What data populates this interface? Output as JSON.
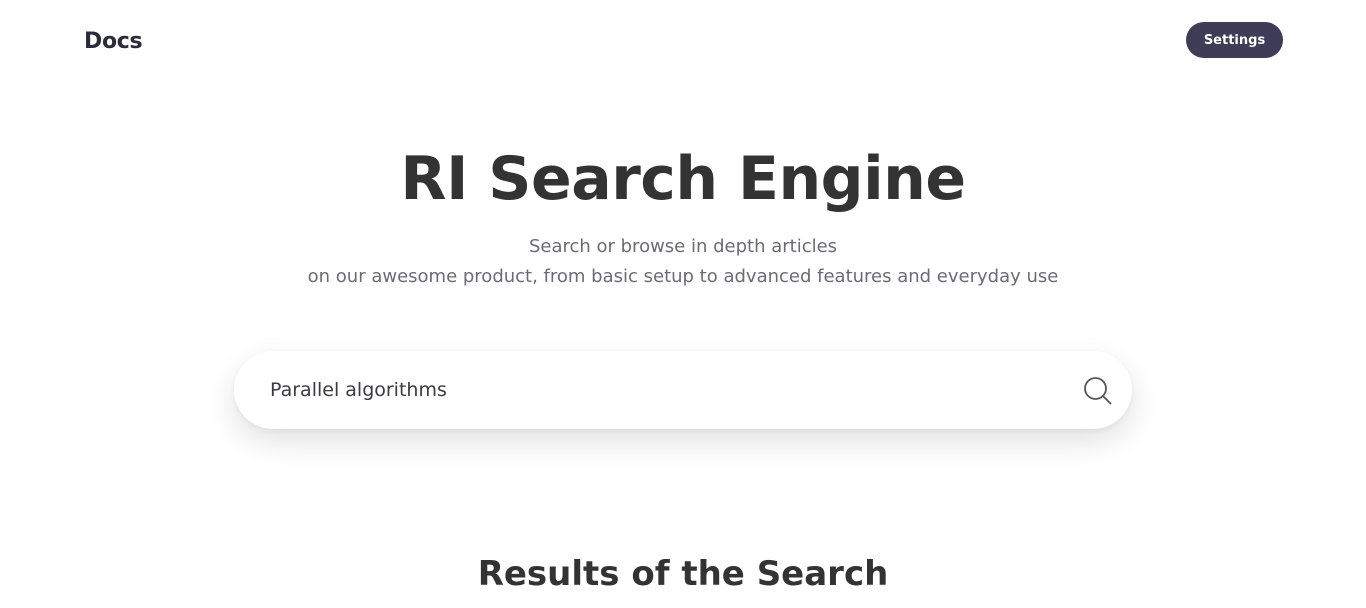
{
  "header": {
    "brand": "Docs",
    "settings_label": "Settings"
  },
  "hero": {
    "title": "RI Search Engine",
    "subtitle_line1": "Search or browse in depth articles",
    "subtitle_line2": "on our awesome product, from basic setup to advanced features and everyday use"
  },
  "search": {
    "value": "Parallel algorithms",
    "placeholder": "",
    "icon": "search-icon"
  },
  "results": {
    "title": "Results of the Search"
  },
  "colors": {
    "accent": "#3e3c56",
    "text": "#333333",
    "muted": "#6b6b78",
    "background": "#ffffff"
  }
}
